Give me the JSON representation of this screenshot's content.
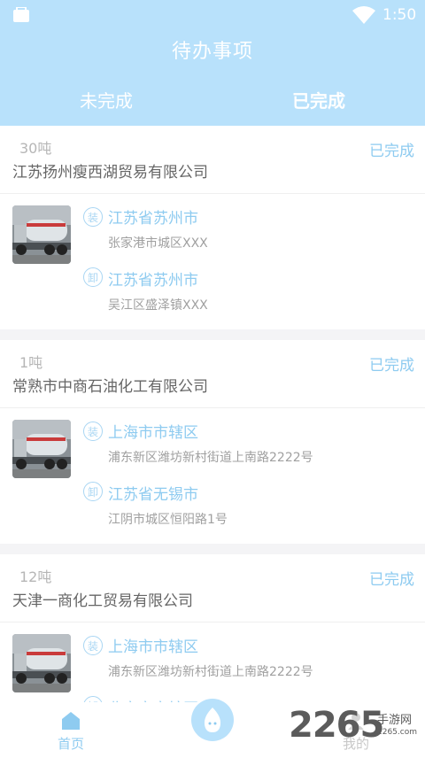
{
  "status_bar": {
    "time": "1:50"
  },
  "header": {
    "title": "待办事项"
  },
  "tabs": [
    {
      "label": "未完成"
    },
    {
      "label": "已完成"
    }
  ],
  "orders": [
    {
      "weight": "30吨",
      "status": "已完成",
      "company": "江苏扬州瘦西湖贸易有限公司",
      "load": {
        "icon_text": "装",
        "city": "江苏省苏州市",
        "address": "张家港市城区XXX"
      },
      "unload": {
        "icon_text": "卸",
        "city": "江苏省苏州市",
        "address": "吴江区盛泽镇XXX"
      }
    },
    {
      "weight": "1吨",
      "status": "已完成",
      "company": "常熟市中商石油化工有限公司",
      "load": {
        "icon_text": "装",
        "city": "上海市市辖区",
        "address": "浦东新区潍坊新村街道上南路2222号"
      },
      "unload": {
        "icon_text": "卸",
        "city": "江苏省无锡市",
        "address": "江阴市城区恒阳路1号"
      }
    },
    {
      "weight": "12吨",
      "status": "已完成",
      "company": "天津一商化工贸易有限公司",
      "load": {
        "icon_text": "装",
        "city": "上海市市辖区",
        "address": "浦东新区潍坊新村街道上南路2222号"
      },
      "unload": {
        "icon_text": "卸",
        "city": "北京市市辖区",
        "address": ""
      }
    }
  ],
  "bottom_nav": {
    "home_label": "首页",
    "mine_label": "我的"
  },
  "watermark": {
    "number": "2265",
    "name": "手游网",
    "url": "2265.com"
  },
  "colors": {
    "accent": "#b8e1fb",
    "accent_text": "#8ecbf0"
  }
}
